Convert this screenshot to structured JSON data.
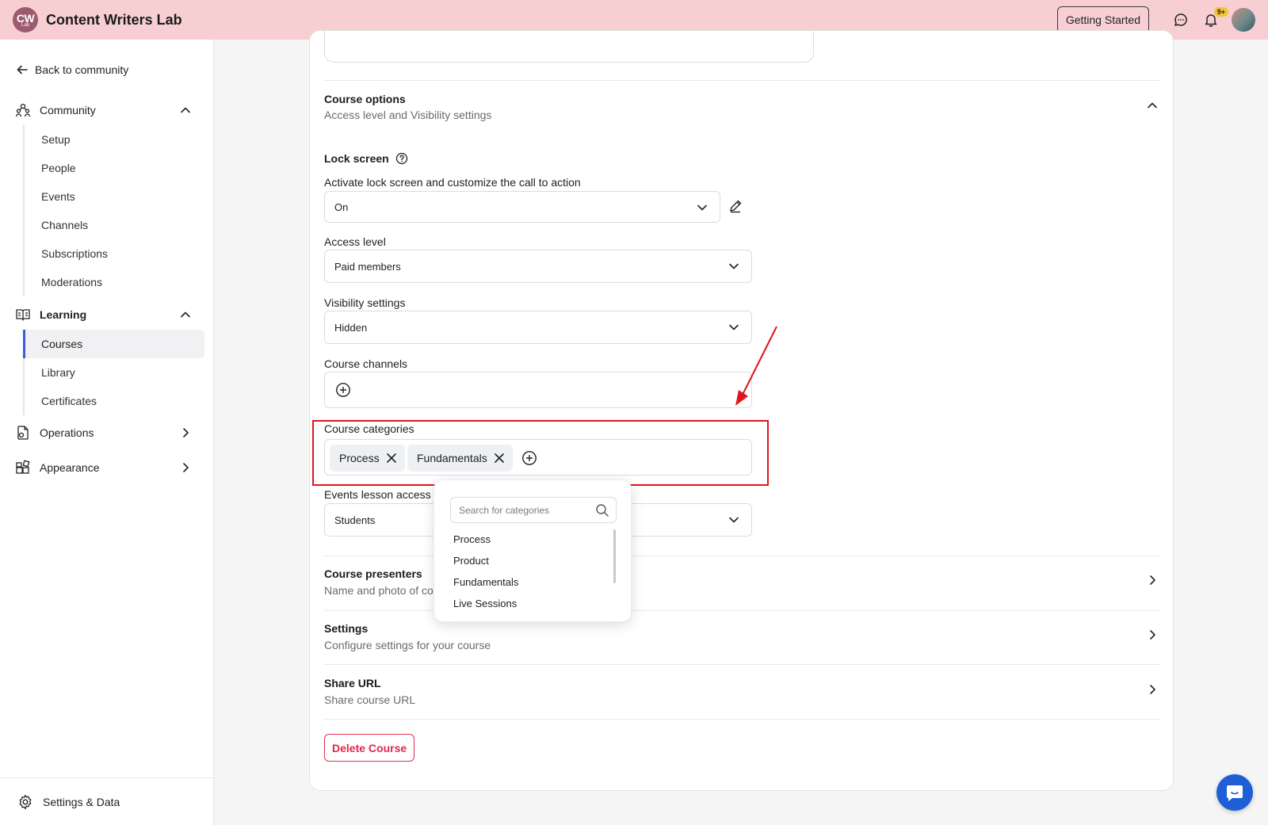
{
  "header": {
    "logo_line1": "CW",
    "logo_line2": "Lab",
    "app_title": "Content Writers Lab",
    "getting_started": "Getting Started",
    "notification_badge": "9+"
  },
  "sidebar": {
    "back": "Back to community",
    "community": {
      "label": "Community",
      "items": [
        "Setup",
        "People",
        "Events",
        "Channels",
        "Subscriptions",
        "Moderations"
      ]
    },
    "learning": {
      "label": "Learning",
      "items": [
        "Courses",
        "Library",
        "Certificates"
      ],
      "active": "Courses"
    },
    "operations": "Operations",
    "appearance": "Appearance",
    "footer": "Settings & Data"
  },
  "main": {
    "course_options": {
      "title": "Course options",
      "subtitle": "Access level and Visibility settings"
    },
    "lock_screen": {
      "title": "Lock screen",
      "label": "Activate lock screen and customize the call to action",
      "value": "On"
    },
    "access_level": {
      "label": "Access level",
      "value": "Paid members"
    },
    "visibility": {
      "label": "Visibility settings",
      "value": "Hidden"
    },
    "course_channels": {
      "label": "Course channels"
    },
    "course_categories": {
      "label": "Course categories",
      "chips": [
        "Process",
        "Fundamentals"
      ]
    },
    "events_lesson_access": {
      "label": "Events lesson access",
      "value": "Students"
    },
    "presenters": {
      "title": "Course presenters",
      "subtitle": "Name and photo of co"
    },
    "settings": {
      "title": "Settings",
      "subtitle": "Configure settings for your course"
    },
    "share_url": {
      "title": "Share URL",
      "subtitle": "Share course URL"
    },
    "delete_button": "Delete Course"
  },
  "category_dropdown": {
    "placeholder": "Search for categories",
    "options": [
      "Process",
      "Product",
      "Fundamentals",
      "Live Sessions"
    ]
  },
  "colors": {
    "topbar": "#f7cfd2",
    "accent": "#3b5bdb",
    "highlight": "#e0161e",
    "danger": "#e0284a",
    "chat_fab": "#1f5fd6"
  }
}
